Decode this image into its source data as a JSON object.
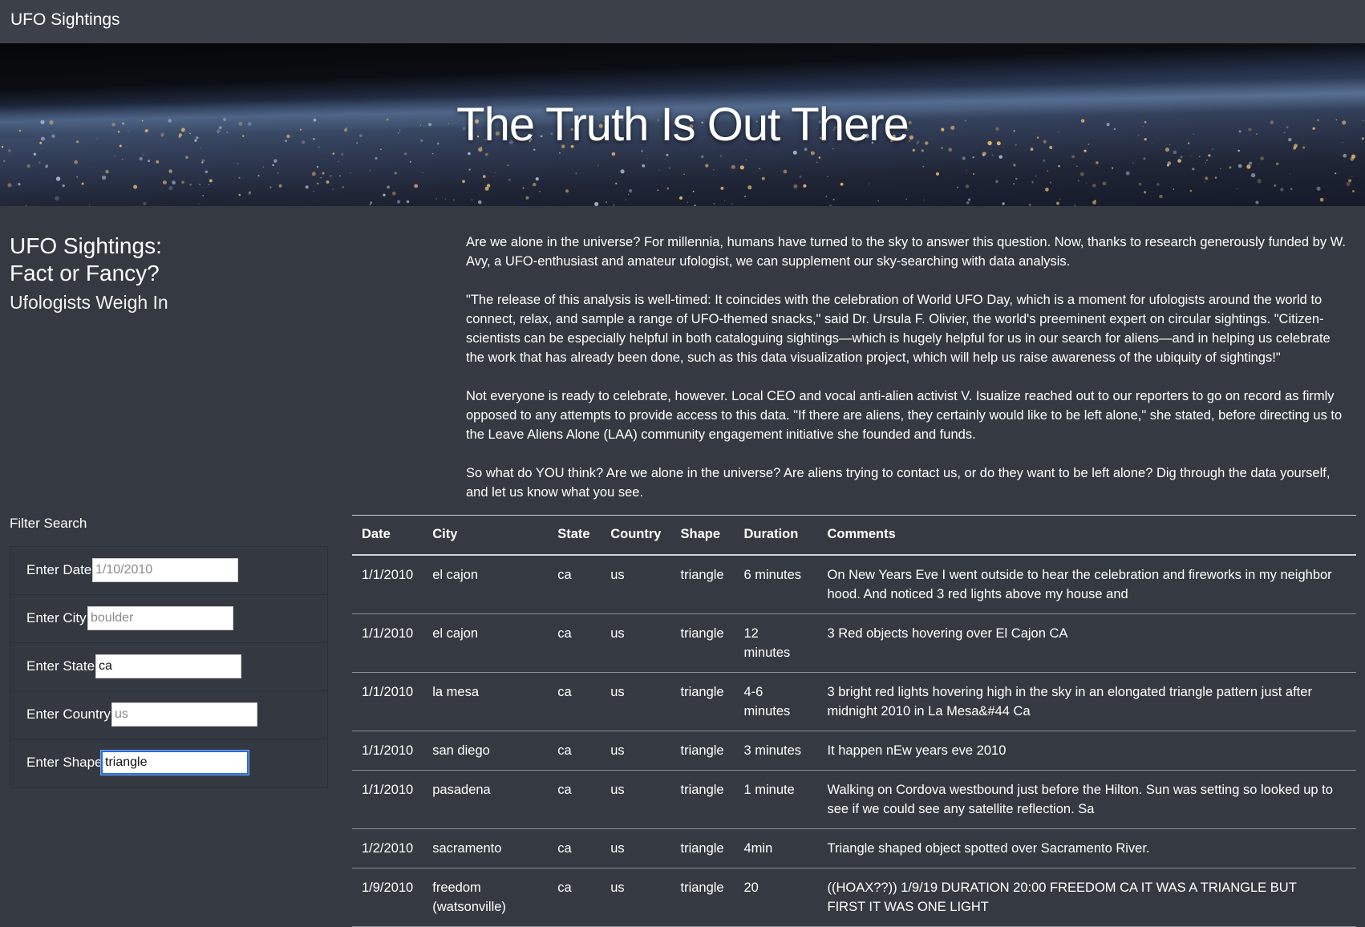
{
  "nav": {
    "brand": "UFO Sightings"
  },
  "hero": {
    "title": "The Truth Is Out There"
  },
  "heading": {
    "title_line1": "UFO Sightings:",
    "title_line2": "Fact or Fancy?",
    "subtitle": "Ufologists Weigh In"
  },
  "article": {
    "paragraphs": [
      "Are we alone in the universe? For millennia, humans have turned to the sky to answer this question. Now, thanks to research generously funded by W. Avy, a UFO-enthusiast and amateur ufologist, we can supplement our sky-searching with data analysis.",
      "\"The release of this analysis is well-timed: It coincides with the celebration of World UFO Day, which is a moment for ufologists around the world to connect, relax, and sample a range of UFO-themed snacks,\" said Dr. Ursula F. Olivier, the world's preeminent expert on circular sightings. \"Citizen-scientists can be especially helpful in both cataloguing sightings—which is hugely helpful for us in our search for aliens—and in helping us celebrate the work that has already been done, such as this data visualization project, which will help us raise awareness of the ubiquity of sightings!\"",
      "Not everyone is ready to celebrate, however. Local CEO and vocal anti-alien activist V. Isualize reached out to our reporters to go on record as firmly opposed to any attempts to provide access to this data. \"If there are aliens, they certainly would like to be left alone,\" she stated, before directing us to the Leave Aliens Alone (LAA) community engagement initiative she founded and funds.",
      "So what do YOU think? Are we alone in the universe? Are aliens trying to contact us, or do they want to be left alone? Dig through the data yourself, and let us know what you see."
    ]
  },
  "filters": {
    "title": "Filter Search",
    "items": [
      {
        "label": "Enter Date",
        "placeholder": "1/10/2010",
        "value": ""
      },
      {
        "label": "Enter City",
        "placeholder": "boulder",
        "value": ""
      },
      {
        "label": "Enter State",
        "placeholder": "",
        "value": "ca"
      },
      {
        "label": "Enter Country",
        "placeholder": "us",
        "value": ""
      },
      {
        "label": "Enter Shape",
        "placeholder": "",
        "value": "triangle"
      }
    ]
  },
  "table": {
    "headers": [
      "Date",
      "City",
      "State",
      "Country",
      "Shape",
      "Duration",
      "Comments"
    ],
    "rows": [
      [
        "1/1/2010",
        "el cajon",
        "ca",
        "us",
        "triangle",
        "6 minutes",
        "On New Years Eve I went outside to hear the celebration and fireworks in my neighbor hood. And noticed 3 red lights above my house and"
      ],
      [
        "1/1/2010",
        "el cajon",
        "ca",
        "us",
        "triangle",
        "12 minutes",
        "3 Red objects hovering over El Cajon CA"
      ],
      [
        "1/1/2010",
        "la mesa",
        "ca",
        "us",
        "triangle",
        "4-6 minutes",
        "3 bright red lights hovering high in the sky in an elongated triangle pattern just after midnight 2010 in La Mesa&#44 Ca"
      ],
      [
        "1/1/2010",
        "san diego",
        "ca",
        "us",
        "triangle",
        "3 minutes",
        "It happen nEw years eve 2010"
      ],
      [
        "1/1/2010",
        "pasadena",
        "ca",
        "us",
        "triangle",
        "1 minute",
        "Walking on Cordova westbound just before the Hilton. Sun was setting so looked up to see if we could see any satellite reflection. Sa"
      ],
      [
        "1/2/2010",
        "sacramento",
        "ca",
        "us",
        "triangle",
        "4min",
        "Triangle shaped object spotted over Sacramento River."
      ],
      [
        "1/9/2010",
        "freedom (watsonville)",
        "ca",
        "us",
        "triangle",
        "20",
        "((HOAX??)) 1/9/19 DURATION 20:00 FREEDOM CA IT WAS A TRIANGLE BUT FIRST IT WAS ONE LIGHT"
      ]
    ]
  }
}
